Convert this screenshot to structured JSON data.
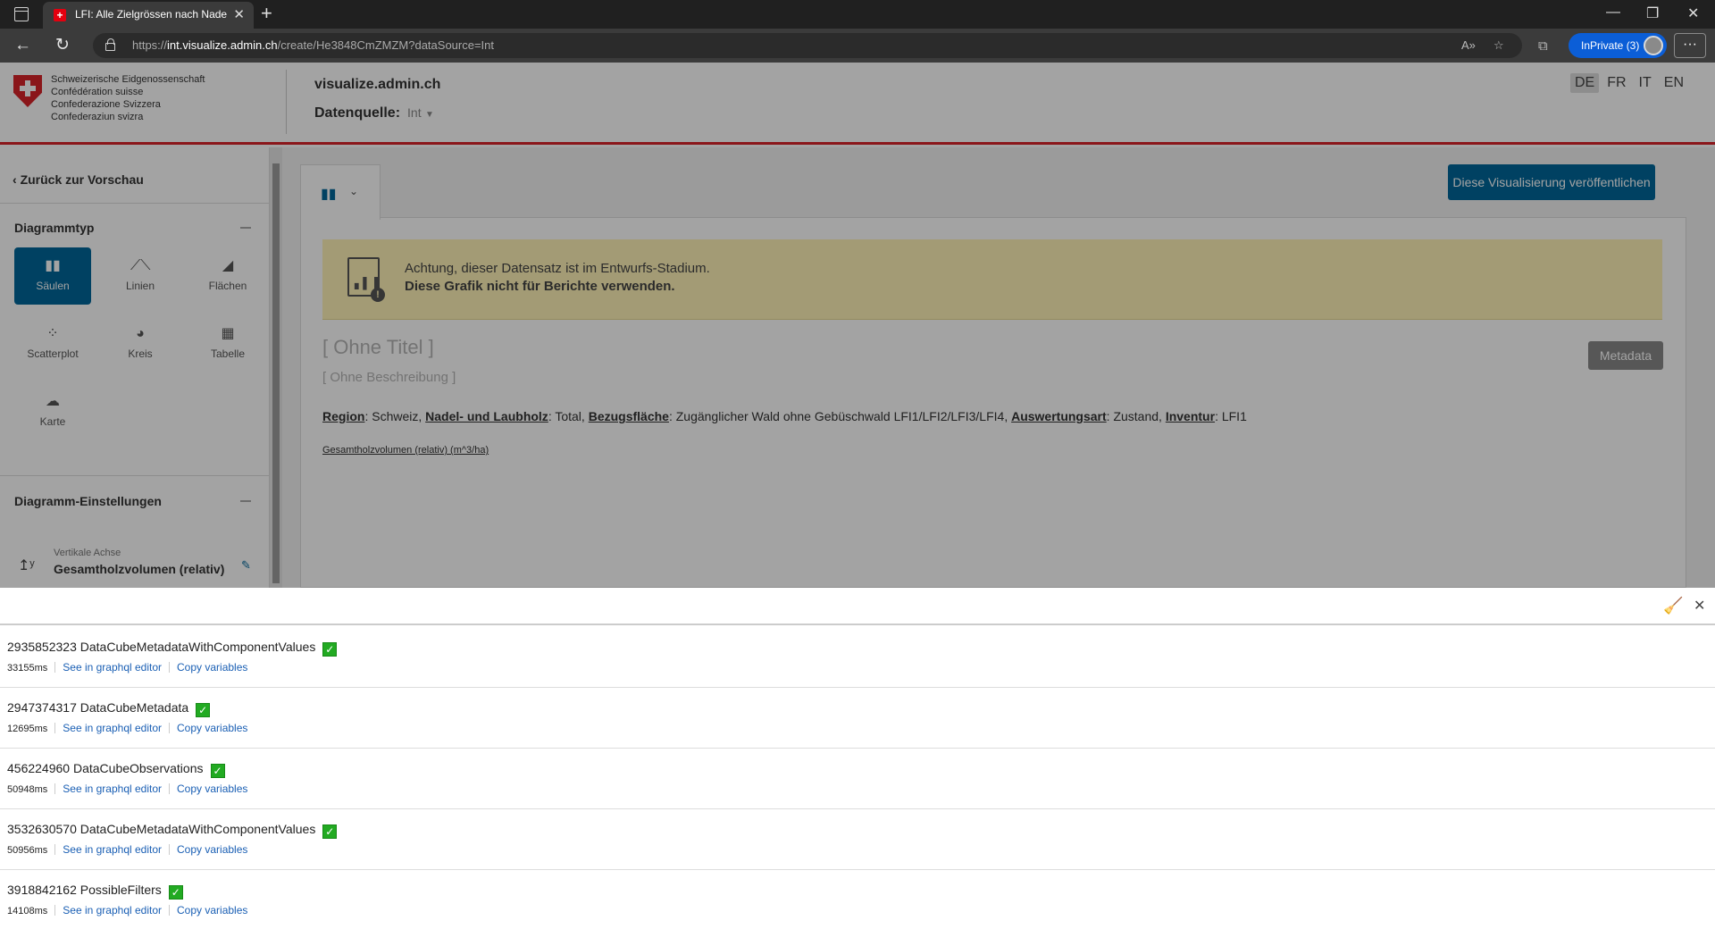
{
  "browser": {
    "tab_title": "LFI: Alle Zielgrössen nach Nadel-",
    "url_prefix": "https://",
    "url_host": "int.visualize.admin.ch",
    "url_path": "/create/He3848CmZMZM?dataSource=Int",
    "inprivate_label": "InPrivate (3)",
    "more_label": "···"
  },
  "header": {
    "confederation": [
      "Schweizerische Eidgenossenschaft",
      "Confédération suisse",
      "Confederazione Svizzera",
      "Confederaziun svizra"
    ],
    "site_title": "visualize.admin.ch",
    "datasource_label": "Datenquelle:",
    "datasource_value": "Int",
    "languages": [
      "DE",
      "FR",
      "IT",
      "EN"
    ],
    "active_language": "DE"
  },
  "sidebar": {
    "back_label": "Zurück zur Vorschau",
    "chart_type_heading": "Diagrammtyp",
    "chart_types": [
      {
        "label": "Säulen",
        "icon": "column-chart-icon",
        "selected": true
      },
      {
        "label": "Linien",
        "icon": "line-chart-icon",
        "selected": false
      },
      {
        "label": "Flächen",
        "icon": "area-chart-icon",
        "selected": false
      },
      {
        "label": "Scatterplot",
        "icon": "scatterplot-icon",
        "selected": false
      },
      {
        "label": "Kreis",
        "icon": "pie-chart-icon",
        "selected": false
      },
      {
        "label": "Tabelle",
        "icon": "table-icon",
        "selected": false
      },
      {
        "label": "Karte",
        "icon": "map-icon",
        "selected": false
      }
    ],
    "settings_heading": "Diagramm-Einstellungen",
    "vertical_axis_label": "Vertikale Achse",
    "vertical_axis_value": "Gesamtholzvolumen (relativ)"
  },
  "main": {
    "publish_label": "Diese Visualisierung veröffentlichen",
    "warning_line1": "Achtung, dieser Datensatz ist im Entwurfs-Stadium.",
    "warning_line2": "Diese Grafik nicht für Berichte verwenden.",
    "title_placeholder": "[ Ohne Titel ]",
    "description_placeholder": "[ Ohne Beschreibung ]",
    "metadata_label": "Metadata",
    "filters": [
      {
        "key": "Region",
        "value": "Schweiz"
      },
      {
        "key": "Nadel- und Laubholz",
        "value": "Total"
      },
      {
        "key": "Bezugsfläche",
        "value": "Zugänglicher Wald ohne Gebüschwald LFI1/LFI2/LFI3/LFI4"
      },
      {
        "key": "Auswertungsart",
        "value": "Zustand"
      },
      {
        "key": "Inventur",
        "value": "LFI1"
      }
    ],
    "y_axis_link": "Gesamtholzvolumen (relativ) (m^3/ha)"
  },
  "devtools": {
    "editor_link": "See in graphql editor",
    "copy_link": "Copy variables",
    "requests": [
      {
        "id": "2935852323",
        "name": "DataCubeMetadataWithComponentValues",
        "duration": "33155ms"
      },
      {
        "id": "2947374317",
        "name": "DataCubeMetadata",
        "duration": "12695ms"
      },
      {
        "id": "456224960",
        "name": "DataCubeObservations",
        "duration": "50948ms"
      },
      {
        "id": "3532630570",
        "name": "DataCubeMetadataWithComponentValues",
        "duration": "50956ms"
      },
      {
        "id": "3918842162",
        "name": "PossibleFilters",
        "duration": "14108ms"
      }
    ]
  }
}
